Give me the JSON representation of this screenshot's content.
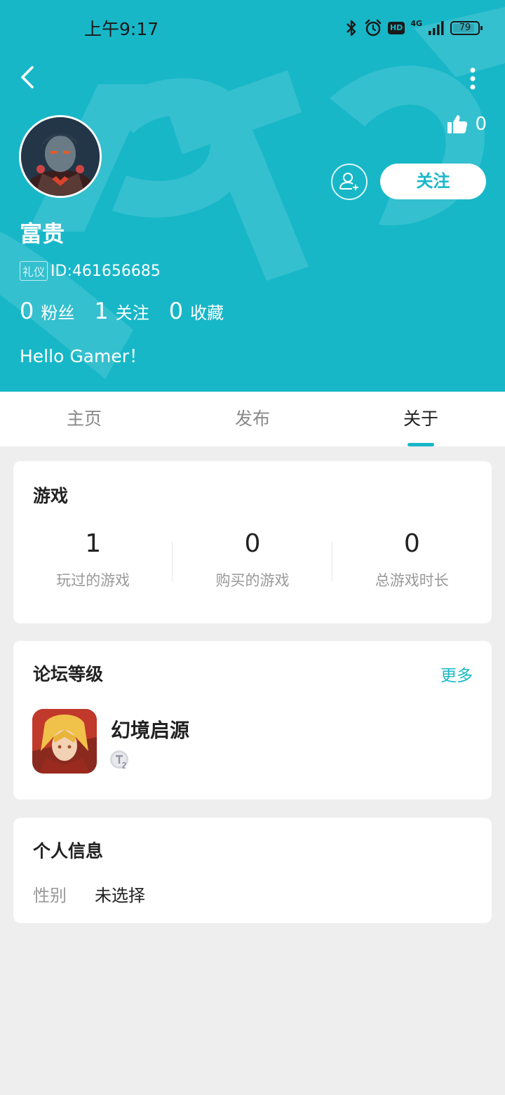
{
  "status_bar": {
    "time": "上午9:17",
    "hd_label": "HD",
    "network": "4G",
    "battery": "79"
  },
  "header": {
    "likes_count": "0",
    "follow_label": "关注",
    "username": "富贵",
    "badge": "礼仪",
    "user_id": "ID:461656685",
    "stats": [
      {
        "value": "0",
        "label": "粉丝"
      },
      {
        "value": "1",
        "label": "关注"
      },
      {
        "value": "0",
        "label": "收藏"
      }
    ],
    "bio": "Hello Gamer！"
  },
  "tabs": [
    {
      "label": "主页",
      "active": false
    },
    {
      "label": "发布",
      "active": false
    },
    {
      "label": "关于",
      "active": true
    }
  ],
  "games_card": {
    "title": "游戏",
    "stats": [
      {
        "value": "1",
        "label": "玩过的游戏"
      },
      {
        "value": "0",
        "label": "购买的游戏"
      },
      {
        "value": "0",
        "label": "总游戏时长"
      }
    ]
  },
  "forum_card": {
    "title": "论坛等级",
    "more_label": "更多",
    "game_name": "幻境启源"
  },
  "info_card": {
    "title": "个人信息",
    "gender_label": "性别",
    "gender_value": "未选择"
  },
  "colors": {
    "accent": "#17b7c8",
    "background": "#eeeeee",
    "card": "#ffffff"
  }
}
